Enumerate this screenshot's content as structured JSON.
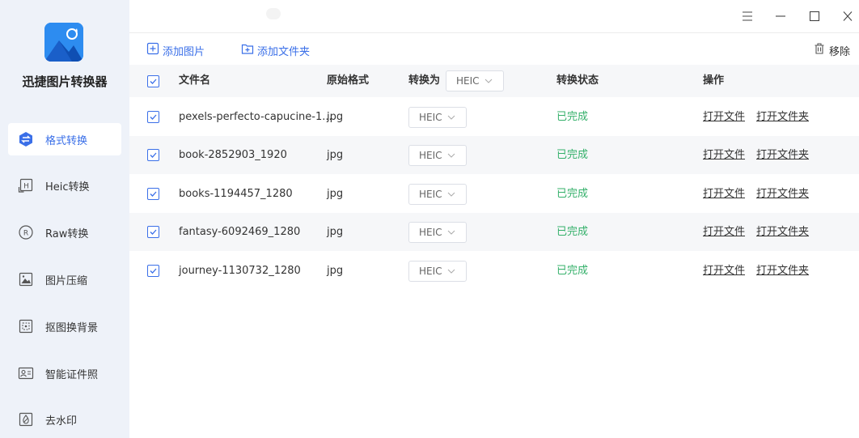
{
  "app": {
    "title": "迅捷图片转换器"
  },
  "sidebar": {
    "items": [
      {
        "label": "格式转换",
        "icon": "format-convert-icon",
        "active": true
      },
      {
        "label": "Heic转换",
        "icon": "heic-icon",
        "active": false
      },
      {
        "label": "Raw转换",
        "icon": "raw-icon",
        "active": false
      },
      {
        "label": "图片压缩",
        "icon": "image-compress-icon",
        "active": false
      },
      {
        "label": "抠图换背景",
        "icon": "cutout-icon",
        "active": false
      },
      {
        "label": "智能证件照",
        "icon": "id-photo-icon",
        "active": false
      },
      {
        "label": "去水印",
        "icon": "watermark-icon",
        "active": false
      }
    ]
  },
  "toolbar": {
    "add_image": "添加图片",
    "add_folder": "添加文件夹",
    "remove": "移除"
  },
  "table": {
    "headers": {
      "filename": "文件名",
      "original_format": "原始格式",
      "convert_to": "转换为",
      "convert_to_value": "HEIC",
      "status": "转换状态",
      "actions": "操作"
    },
    "rows": [
      {
        "name": "pexels-perfecto-capucine-1...",
        "format": "jpg",
        "target": "HEIC",
        "status": "已完成",
        "open_file": "打开文件",
        "open_folder": "打开文件夹"
      },
      {
        "name": "book-2852903_1920",
        "format": "jpg",
        "target": "HEIC",
        "status": "已完成",
        "open_file": "打开文件",
        "open_folder": "打开文件夹"
      },
      {
        "name": "books-1194457_1280",
        "format": "jpg",
        "target": "HEIC",
        "status": "已完成",
        "open_file": "打开文件",
        "open_folder": "打开文件夹"
      },
      {
        "name": "fantasy-6092469_1280",
        "format": "jpg",
        "target": "HEIC",
        "status": "已完成",
        "open_file": "打开文件",
        "open_folder": "打开文件夹"
      },
      {
        "name": "journey-1130732_1280",
        "format": "jpg",
        "target": "HEIC",
        "status": "已完成",
        "open_file": "打开文件",
        "open_folder": "打开文件夹"
      }
    ]
  },
  "colors": {
    "accent": "#3a6fe8",
    "status_done": "#34b06a",
    "sidebar_bg": "#eef2f9",
    "logo": "#2d8cf0"
  }
}
